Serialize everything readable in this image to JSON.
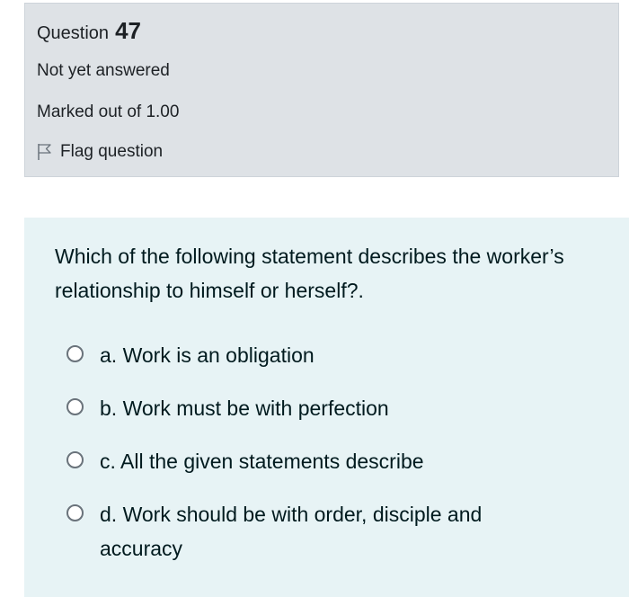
{
  "info": {
    "question_word": "Question",
    "question_number": "47",
    "state": "Not yet answered",
    "grade": "Marked out of 1.00",
    "flag_label": "Flag question",
    "flag_icon": "flag-icon"
  },
  "question": {
    "text": "Which of the following statement describes the worker’s relationship to himself or herself?.",
    "answers": [
      {
        "label": "a. Work is an obligation",
        "selected": false
      },
      {
        "label": "b. Work must be with perfection",
        "selected": false
      },
      {
        "label": "c. All the given statements describe",
        "selected": false
      },
      {
        "label": "d. Work should be with order, disciple and accuracy",
        "selected": false
      }
    ]
  },
  "colors": {
    "info_bg": "#dee2e6",
    "content_bg": "#e7f3f5",
    "text": "#1d2125"
  }
}
